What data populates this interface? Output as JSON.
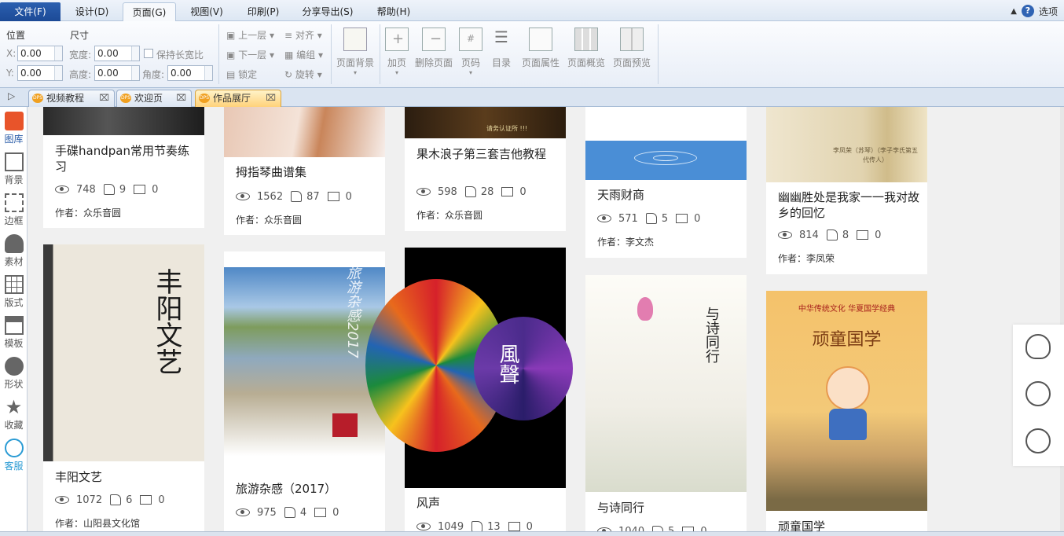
{
  "menubar": {
    "file": "文件(F)",
    "items": [
      "设计(D)",
      "页面(G)",
      "视图(V)",
      "印刷(P)",
      "分享导出(S)",
      "帮助(H)"
    ],
    "options": "选项"
  },
  "ribbon": {
    "position_label": "位置",
    "size_label": "尺寸",
    "x_label": "X:",
    "y_label": "Y:",
    "x_value": "0.00",
    "y_value": "0.00",
    "width_label": "宽度:",
    "height_label": "高度:",
    "angle_label": "角度:",
    "width_value": "0.00",
    "height_value": "0.00",
    "angle_value": "0.00",
    "keep_ratio": "保持长宽比",
    "up_layer": "上一层",
    "down_layer": "下一层",
    "lock": "锁定",
    "align": "对齐",
    "group": "编组",
    "rotate": "旋转",
    "big_buttons": [
      "页面背景",
      "加页",
      "删除页面",
      "页码",
      "目录",
      "页面属性",
      "页面概览",
      "页面预览"
    ]
  },
  "tabs": [
    {
      "label": "视频教程",
      "badge": "DPS"
    },
    {
      "label": "欢迎页",
      "badge": "DPS"
    },
    {
      "label": "作品展厅",
      "badge": "DPS"
    }
  ],
  "sidebar": [
    "图库",
    "背景",
    "边框",
    "素材",
    "版式",
    "模板",
    "形状",
    "收藏",
    "客服"
  ],
  "cards_row1": [
    {
      "title": "手碟handpan常用节奏练习",
      "views": "748",
      "likes": "9",
      "comments": "0",
      "author": "作者：众乐音圆"
    },
    {
      "title": "拇指琴曲谱集",
      "views": "1562",
      "likes": "87",
      "comments": "0",
      "author": "作者：众乐音圆"
    },
    {
      "title": "果木浪子第三套吉他教程",
      "views": "598",
      "likes": "28",
      "comments": "0",
      "author": "作者：众乐音圆",
      "img_text": "请务认证所 !!!"
    },
    {
      "title": "天雨财商",
      "views": "571",
      "likes": "5",
      "comments": "0",
      "author": "作者：李文杰"
    },
    {
      "title": "幽幽胜处是我家一一我对故乡的回忆",
      "views": "814",
      "likes": "8",
      "comments": "0",
      "author": "作者：李凤荣",
      "img_text": "李凤荣（苏琴）（李子李氏第五代传人）"
    }
  ],
  "cards_row2": [
    {
      "title": "丰阳文艺",
      "views": "1072",
      "likes": "6",
      "comments": "0",
      "author": "作者：山阳县文化馆",
      "img_text": "丰阳文艺"
    },
    {
      "title": "旅游杂感（2017）",
      "views": "975",
      "likes": "4",
      "comments": "0",
      "author": "",
      "img_text": "旅游杂感2017"
    },
    {
      "title": "风声",
      "views": "1049",
      "likes": "13",
      "comments": "0",
      "author": "",
      "img_text": "風聲"
    },
    {
      "title": "与诗同行",
      "views": "1040",
      "likes": "5",
      "comments": "0",
      "author": "",
      "img_text": "与诗同行"
    },
    {
      "title": "顽童国学",
      "views": "",
      "likes": "",
      "comments": "",
      "author": "",
      "img_text": "顽童国学",
      "img_top": "中华传统文化 华夏国学经典"
    }
  ]
}
